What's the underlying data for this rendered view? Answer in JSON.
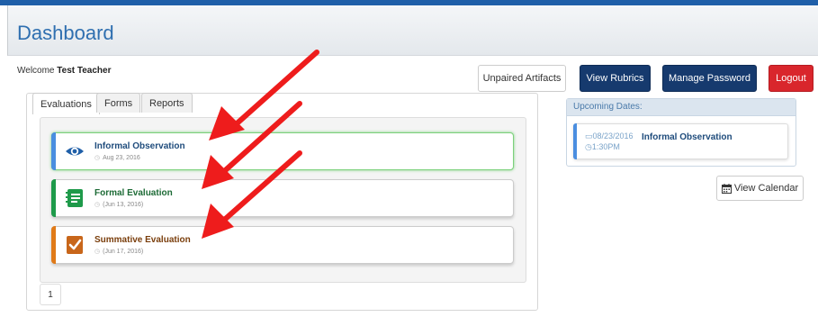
{
  "header": {
    "title": "Dashboard"
  },
  "welcome": {
    "prefix": "Welcome ",
    "user": "Test Teacher"
  },
  "buttons": {
    "unpaired": "Unpaired Artifacts",
    "rubrics": "View Rubrics",
    "password": "Manage Password",
    "logout": "Logout"
  },
  "tabs": [
    {
      "label": "Evaluations",
      "active": true
    },
    {
      "label": "Forms"
    },
    {
      "label": "Reports"
    }
  ],
  "cards": [
    {
      "title": "Informal Observation",
      "date": "Aug 23, 2016",
      "accent": "#4a8ee0",
      "title_color": "#1f4c7c",
      "icon": "eye-icon"
    },
    {
      "title": "Formal Evaluation",
      "date": "(Jun 13, 2016)",
      "accent": "#1e9a4a",
      "title_color": "#1d6b36",
      "icon": "notebook-icon"
    },
    {
      "title": "Summative Evaluation",
      "date": "(Jun 17, 2016)",
      "accent": "#e07a18",
      "title_color": "#7a3e0c",
      "icon": "checkmark-book-icon"
    }
  ],
  "pagination": {
    "current": "1"
  },
  "upcoming": {
    "heading": "Upcoming Dates:",
    "event": {
      "date": "08/23/2016",
      "time": "1:30PM",
      "title": "Informal Observation"
    }
  },
  "calendar_button": "View Calendar",
  "colors": {
    "header_text": "#2f6fb0",
    "navy": "#163a6e",
    "red": "#d9262c",
    "arrow": "#ee1c1c"
  }
}
